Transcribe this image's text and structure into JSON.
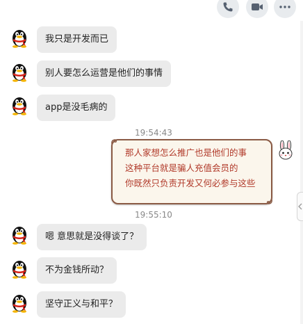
{
  "toolbar": {
    "icons": [
      "phone-icon",
      "video-camera-icon",
      "more-icon"
    ]
  },
  "messages": [
    {
      "sender": "friend",
      "text": "我只是开发而已"
    },
    {
      "sender": "friend",
      "text": "别人要怎么运营是他们的事情"
    },
    {
      "sender": "friend",
      "text": "app是没毛病的"
    },
    {
      "type": "timestamp",
      "text": "19:54:43"
    },
    {
      "sender": "me",
      "lines": [
        "那人家想怎么推广也是他们的事",
        "这种平台就是骗人充值会员的",
        "你既然只负责开发又何必参与这些"
      ]
    },
    {
      "type": "timestamp",
      "text": "19:55:10"
    },
    {
      "sender": "friend",
      "text": "嗯 意思就是没得谈了？"
    },
    {
      "sender": "friend",
      "text": "不为金钱所动？"
    },
    {
      "sender": "friend",
      "text": "坚守正义与和平？"
    }
  ],
  "colors": {
    "friend_bubble": "#ebebeb",
    "my_bubble_bg": "#fbf6ec",
    "my_bubble_border": "#8a5a44",
    "my_text": "#b13a2a",
    "timestamp": "#888888"
  }
}
